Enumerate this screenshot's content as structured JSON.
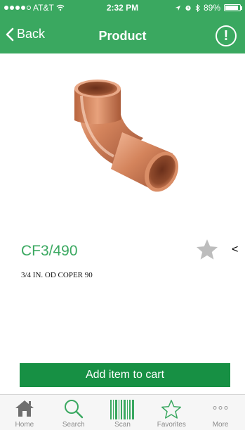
{
  "status_bar": {
    "carrier": "AT&T",
    "time": "2:32 PM",
    "battery": "89%",
    "battery_level": 0.89
  },
  "nav": {
    "back_label": "Back",
    "title": "Product",
    "info_symbol": "!"
  },
  "product": {
    "image_icon": "copper-elbow-fitting",
    "code": "CF3/490",
    "description": "3/4 IN. OD COPER 90",
    "share_symbol": "<"
  },
  "cart_button": {
    "label": "Add item to cart"
  },
  "tabs": [
    {
      "label": "Home",
      "icon": "home-icon"
    },
    {
      "label": "Search",
      "icon": "search-icon"
    },
    {
      "label": "Scan",
      "icon": "barcode-icon"
    },
    {
      "label": "Favorites",
      "icon": "star-icon"
    },
    {
      "label": "More",
      "icon": "more-icon"
    }
  ],
  "colors": {
    "brand_green": "#3aa860",
    "button_green": "#179044",
    "copper": "#c8704a"
  }
}
